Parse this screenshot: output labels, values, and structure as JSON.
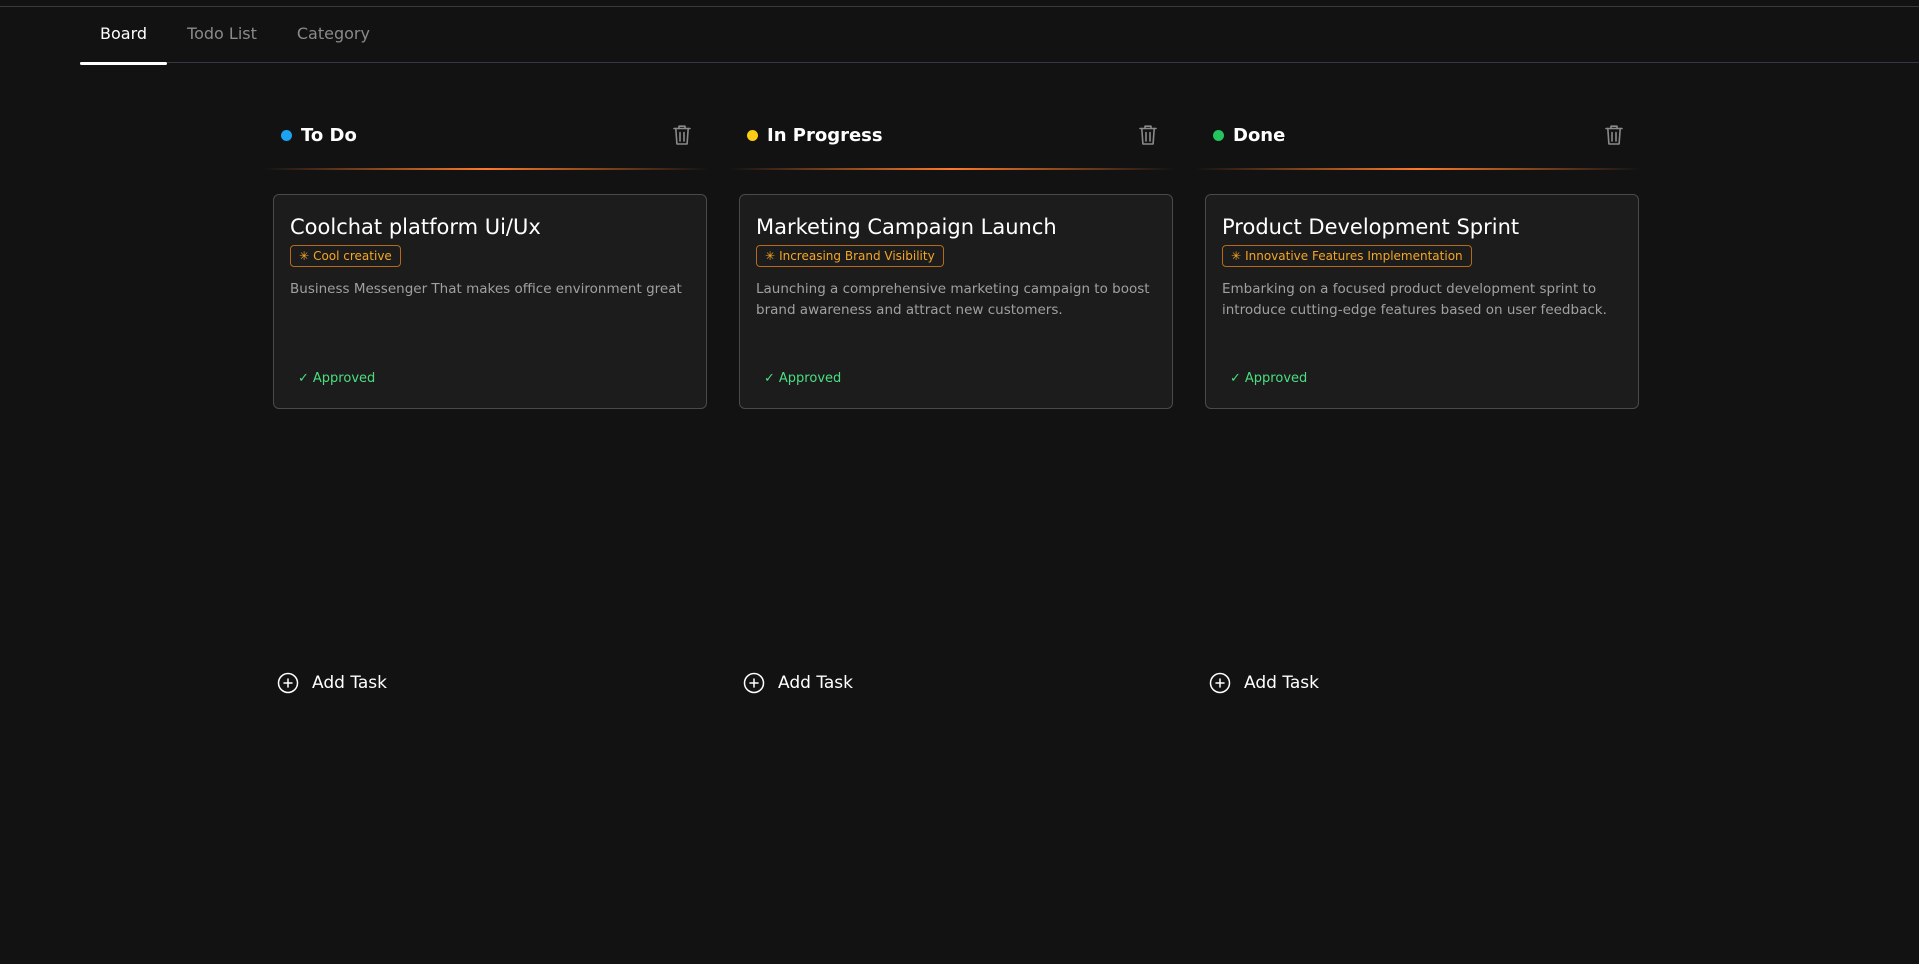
{
  "tabs": [
    {
      "label": "Board",
      "active": true
    },
    {
      "label": "Todo List",
      "active": false
    },
    {
      "label": "Category",
      "active": false
    }
  ],
  "columns": [
    {
      "title": "To Do",
      "dot_color": "#1da1f2",
      "card": {
        "title": "Coolchat platform Ui/Ux",
        "category": "Cool creative",
        "description": "Business Messenger That makes office environment great",
        "status": "Approved"
      },
      "add_label": "Add Task"
    },
    {
      "title": "In Progress",
      "dot_color": "#facc15",
      "card": {
        "title": "Marketing Campaign Launch",
        "category": "Increasing Brand Visibility",
        "description": "Launching a comprehensive marketing campaign to boost brand awareness and attract new customers.",
        "status": "Approved"
      },
      "add_label": "Add Task"
    },
    {
      "title": "Done",
      "dot_color": "#22c55e",
      "card": {
        "title": "Product Development Sprint",
        "category": "Innovative Features Implementation",
        "description": "Embarking on a focused product development sprint to introduce cutting-edge features based on user feedback.",
        "status": "Approved"
      },
      "add_label": "Add Task"
    }
  ],
  "icons": {
    "delete": "trash-icon",
    "add": "plus-circle-icon",
    "category": "sparkle-icon",
    "status": "check-icon"
  },
  "colors": {
    "accent_line": "#ff7a29",
    "category_text": "#f5a623",
    "approved": "#4ade80"
  }
}
